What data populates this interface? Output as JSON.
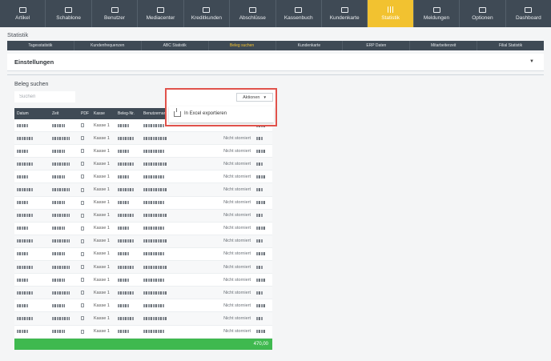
{
  "nav": [
    {
      "label": "Artikel",
      "icon": "box-icon",
      "active": false
    },
    {
      "label": "Schablone",
      "icon": "template-icon",
      "active": false
    },
    {
      "label": "Benutzer",
      "icon": "users-icon",
      "active": false
    },
    {
      "label": "Mediacenter",
      "icon": "monitor-icon",
      "active": false
    },
    {
      "label": "Kreditkunden",
      "icon": "card-icon",
      "active": false
    },
    {
      "label": "Abschlüsse",
      "icon": "document-icon",
      "active": false
    },
    {
      "label": "Kassenbuch",
      "icon": "book-icon",
      "active": false
    },
    {
      "label": "Kundenkarte",
      "icon": "customer-card-icon",
      "active": false
    },
    {
      "label": "Statistik",
      "icon": "bar-chart-icon",
      "active": true
    },
    {
      "label": "Meldungen",
      "icon": "mail-icon",
      "active": false
    },
    {
      "label": "Optionen",
      "icon": "gear-icon",
      "active": false
    },
    {
      "label": "Dashboard",
      "icon": "dashboard-icon",
      "active": false
    }
  ],
  "page_title": "Statistik",
  "subtabs": [
    {
      "label": "Tagesstatistik",
      "active": false
    },
    {
      "label": "Kundenfrequenzen",
      "active": false
    },
    {
      "label": "ABC Statistik",
      "active": false
    },
    {
      "label": "Beleg suchen",
      "active": true
    },
    {
      "label": "Kundenkarte",
      "active": false
    },
    {
      "label": "ERP Daten",
      "active": false
    },
    {
      "label": "Mitarbeiterzeit",
      "active": false
    },
    {
      "label": "Filial Statistik",
      "active": false
    }
  ],
  "settings": {
    "title": "Einstellungen"
  },
  "section": {
    "title": "Beleg suchen",
    "search_placeholder": "Suchen"
  },
  "actions": {
    "button_label": "Aktionen",
    "menu_item": "In Excel exportieren"
  },
  "table": {
    "headers": [
      "Datum",
      "Zeit",
      "PDF",
      "Kasse",
      "Beleg-Nr.",
      "Benutzername",
      "",
      ""
    ],
    "rows": [
      {
        "kasse": "Kasse 1",
        "status": ""
      },
      {
        "kasse": "Kasse 1",
        "status": "Nicht storniert"
      },
      {
        "kasse": "Kasse 1",
        "status": "Nicht storniert"
      },
      {
        "kasse": "Kasse 1",
        "status": "Nicht storniert"
      },
      {
        "kasse": "Kasse 1",
        "status": "Nicht storniert"
      },
      {
        "kasse": "Kasse 1",
        "status": "Nicht storniert"
      },
      {
        "kasse": "Kasse 1",
        "status": "Nicht storniert"
      },
      {
        "kasse": "Kasse 1",
        "status": "Nicht storniert"
      },
      {
        "kasse": "Kasse 1",
        "status": "Nicht storniert"
      },
      {
        "kasse": "Kasse 1",
        "status": "Nicht storniert"
      },
      {
        "kasse": "Kasse 1",
        "status": "Nicht storniert"
      },
      {
        "kasse": "Kasse 1",
        "status": "Nicht storniert"
      },
      {
        "kasse": "Kasse 1",
        "status": "Nicht storniert"
      },
      {
        "kasse": "Kasse 1",
        "status": "Nicht storniert"
      },
      {
        "kasse": "Kasse 1",
        "status": "Nicht storniert"
      },
      {
        "kasse": "Kasse 1",
        "status": "Nicht storniert"
      },
      {
        "kasse": "Kasse 1",
        "status": "Nicht storniert"
      }
    ],
    "total": "470,00"
  },
  "colors": {
    "nav_bg": "#3f4a55",
    "accent": "#f2c230",
    "total_bg": "#3fb94f",
    "highlight": "#e0524b"
  }
}
